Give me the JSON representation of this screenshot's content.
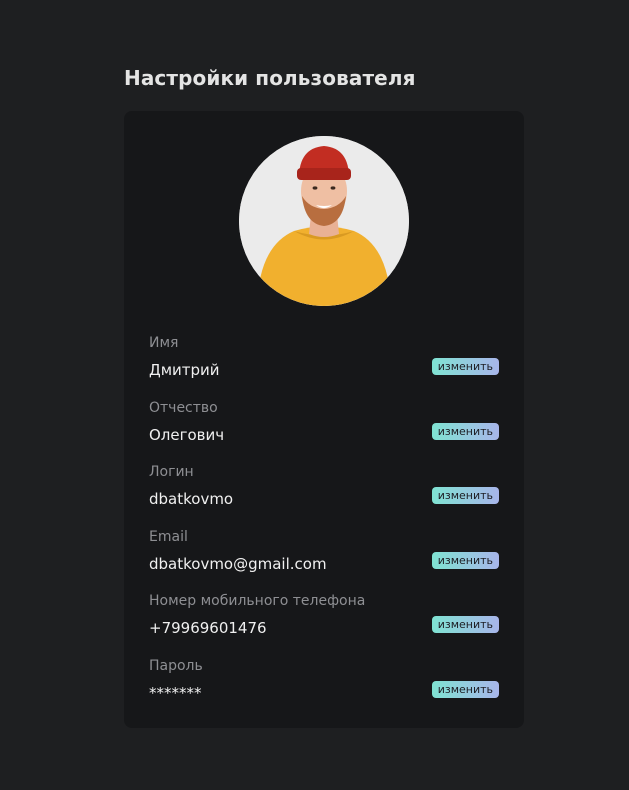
{
  "page": {
    "title": "Настройки пользователя"
  },
  "fields": [
    {
      "label": "Имя",
      "value": "Дмитрий",
      "action": "изменить"
    },
    {
      "label": "Отчество",
      "value": "Олегович",
      "action": "изменить"
    },
    {
      "label": "Логин",
      "value": "dbatkovmo",
      "action": "изменить"
    },
    {
      "label": "Email",
      "value": "dbatkovmo@gmail.com",
      "action": "изменить"
    },
    {
      "label": "Номер мобильного телефона",
      "value": "+79969601476",
      "action": "изменить"
    },
    {
      "label": "Пароль",
      "value": "*******",
      "action": "изменить"
    }
  ],
  "colors": {
    "background": "#1e1f21",
    "card": "#161719",
    "button_gradient_start": "#7fe3d2",
    "button_gradient_end": "#a8b5ea"
  }
}
